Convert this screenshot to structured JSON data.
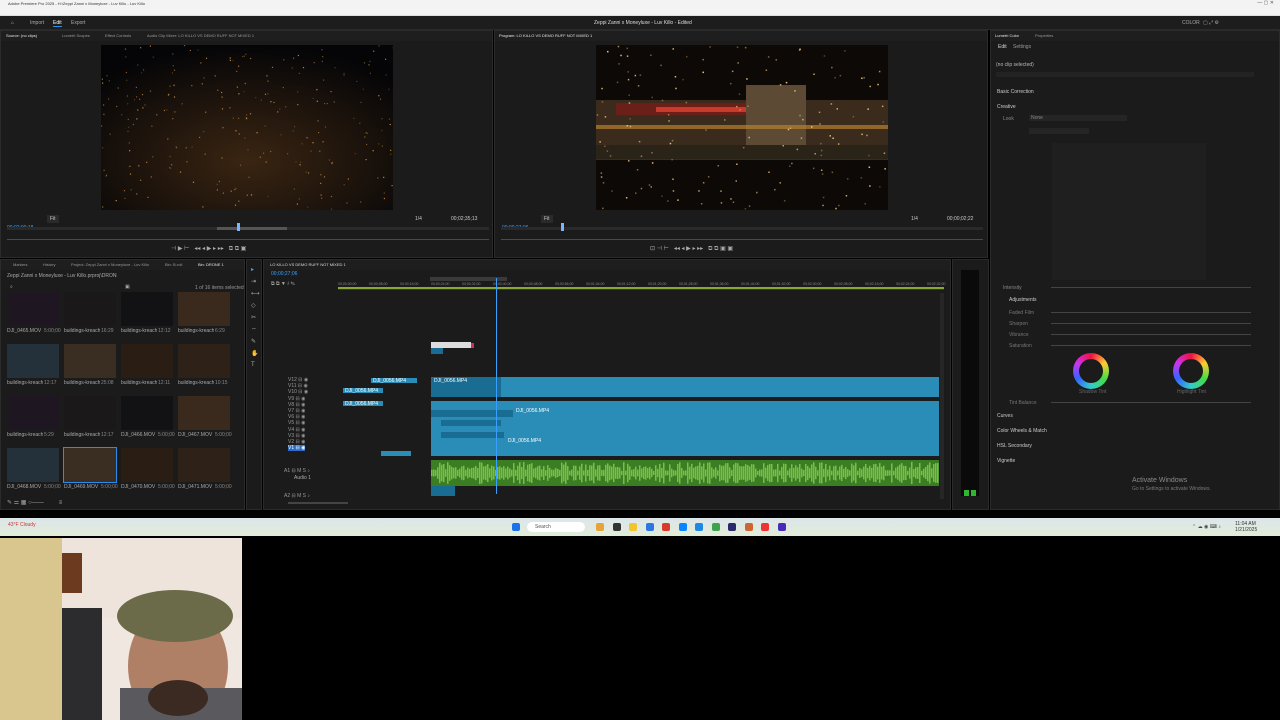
{
  "window": {
    "title": "Adobe Premiere Pro 2025 - H:\\Zeppi Zanni x Moneyluxe - Luv Killo - Luv Killo",
    "menu": [
      "File",
      "Edit",
      "Clip",
      "Sequence",
      "Markers",
      "Graphics and Titles",
      "View",
      "Window",
      "Help"
    ]
  },
  "header": {
    "tabs": [
      "Import",
      "Edit",
      "Export"
    ],
    "active_tab": "Edit",
    "project_title": "Zeppi Zanni x Moneyluxe - Luv Killo - Edited",
    "right_label": "COLOR"
  },
  "source_monitor": {
    "tabs": [
      "Source: (no clips)",
      "Lumetri Scopes",
      "Effect Controls",
      "Audio Clip Mixer: LO KILLO VS DEMO RUFF NOT MIXED 1"
    ],
    "timecode_left": "00;02;00;18",
    "fit": "Fit",
    "quality": "1/4",
    "timecode_right": "00;02;35;13"
  },
  "program_monitor": {
    "tab": "Program: LO KILLO VS DEMO RUFF NOT MIXED 1",
    "timecode_left": "00;00;27;06",
    "fit": "Fit",
    "quality": "1/4",
    "timecode_right": "00;00;02;22"
  },
  "project_panel": {
    "tabs": [
      "Markers",
      "History",
      "Project: Zeppi Zanni x Moneyluxe - Luv Killo",
      "Bin: B-roll",
      "Bin: DRONE 1"
    ],
    "path": "Zeppi Zanni x Moneyluxe - Luv Killo.prproj\\DRONE 1",
    "count": "1 of 16 items selected",
    "items": [
      {
        "name": "DJI_0465.MOV",
        "dur": "5:00;00"
      },
      {
        "name": "buildings-kreachy-tr...",
        "dur": "16:29"
      },
      {
        "name": "buildings-kreachy-tr...",
        "dur": "12:12"
      },
      {
        "name": "buildings-kreachy-tr...",
        "dur": "6:29"
      },
      {
        "name": "buildings-kreachy-tr...",
        "dur": "12:17"
      },
      {
        "name": "buildings-kreachy-tr...",
        "dur": "25:08"
      },
      {
        "name": "buildings-kreachy-tr...",
        "dur": "12:11"
      },
      {
        "name": "buildings-kreachy-tr...",
        "dur": "10:15"
      },
      {
        "name": "buildings-kreachy-tr...",
        "dur": "5:29"
      },
      {
        "name": "buildings-kreachy-tr...",
        "dur": "12:17"
      },
      {
        "name": "DJI_0466.MOV",
        "dur": "5:00;00"
      },
      {
        "name": "DJI_0467.MOV",
        "dur": "5:00;00"
      },
      {
        "name": "DJI_0468.MOV",
        "dur": "5:00;00"
      },
      {
        "name": "DJI_0469.MOV",
        "dur": "5:00;00"
      },
      {
        "name": "DJI_0470.MOV",
        "dur": "5:00;00"
      },
      {
        "name": "DJI_0471.MOV",
        "dur": "5:00;00"
      }
    ]
  },
  "timeline": {
    "tab": "LO KILLO VS DEMO RUFF NOT MIXED 1",
    "timecode": "00;00;27;06",
    "ruler": [
      "00;00;00;00",
      "00;00;08;00",
      "00;00;16;00",
      "00;00;24;00",
      "00;00;32;00",
      "00;00;40;00",
      "00;00;48;00",
      "00;00;56;00",
      "00;01;04;00",
      "00;01;12;00",
      "00;01;20;00",
      "00;01;28;00",
      "00;01;36;00",
      "00;01;44;00",
      "00;01;52;00",
      "00;02;00;00",
      "00;02;08;00",
      "00;02;16;00",
      "00;02;24;00",
      "00;02;32;00"
    ],
    "video_tracks": [
      "V12",
      "V11",
      "V10",
      "V9",
      "V8",
      "V7",
      "V6",
      "V5",
      "V4",
      "V3",
      "V2",
      "V1"
    ],
    "audio_tracks": [
      "A1",
      "A2"
    ],
    "audio_track_label": "Audio 1",
    "clip_label": "DJI_0056.MP4"
  },
  "lumetri": {
    "tabs": [
      "Lumetri Color",
      "Properties"
    ],
    "subtabs": [
      "Edit",
      "Settings"
    ],
    "selection": "(no clip selected)",
    "sections": [
      "Basic Correction",
      "Creative",
      "Curves",
      "Color Wheels & Match",
      "HSL Secondary",
      "Vignette"
    ],
    "creative_look": "Look",
    "creative_look_value": "None",
    "intensity_label": "Intensity",
    "adjustments_label": "Adjustments",
    "sliders": [
      "Faded Film",
      "Sharpen",
      "Vibrance",
      "Saturation"
    ],
    "wheels": [
      "Shadow Tint",
      "Highlight Tint"
    ],
    "tint_balance": "Tint Balance"
  },
  "watermark": {
    "line1": "Activate Windows",
    "line2": "Go to Settings to activate Windows."
  },
  "taskbar": {
    "search": "Search",
    "time": "11:04 AM",
    "date": "1/21/2025",
    "weather": "43°F Cloudy"
  },
  "colors": {
    "accent": "#2d8ceb",
    "clip_video": "#2a8db8",
    "clip_audio": "#3b7d22",
    "clip_title": "#d12c67"
  }
}
